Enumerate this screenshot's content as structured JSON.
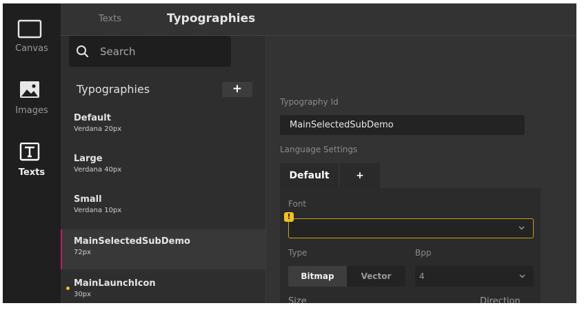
{
  "rail": {
    "items": [
      {
        "label": "Canvas",
        "icon": "canvas-icon"
      },
      {
        "label": "Images",
        "icon": "image-icon"
      },
      {
        "label": "Texts",
        "icon": "text-icon"
      }
    ]
  },
  "header": {
    "tabs": [
      "Texts",
      "Typographies"
    ]
  },
  "search": {
    "placeholder": "Search"
  },
  "list": {
    "title": "Typographies",
    "add_label": "+",
    "items": [
      {
        "name": "Default",
        "sub": "Verdana  20px"
      },
      {
        "name": "Large",
        "sub": "Verdana  40px"
      },
      {
        "name": "Small",
        "sub": "Verdana  10px"
      },
      {
        "name": "MainSelectedSubDemo",
        "sub": " 72px"
      },
      {
        "name": "MainLaunchIcon",
        "sub": " 30px"
      }
    ]
  },
  "detail": {
    "id_label": "Typography Id",
    "id_value": "MainSelectedSubDemo",
    "lang_label": "Language Settings",
    "lang_tabs": [
      "Default",
      "+"
    ],
    "font_label": "Font",
    "font_value": "",
    "warning": "!",
    "type_label": "Type",
    "type_options": [
      "Bitmap",
      "Vector"
    ],
    "bpp_label": "Bpp",
    "bpp_value": "4",
    "size_label": "Size",
    "direction_label": "Direction"
  },
  "colors": {
    "selection_bar": "#c2186b",
    "warning": "#f2c21b",
    "panel": "#2b2b2b",
    "rail": "#1f1f1f"
  }
}
